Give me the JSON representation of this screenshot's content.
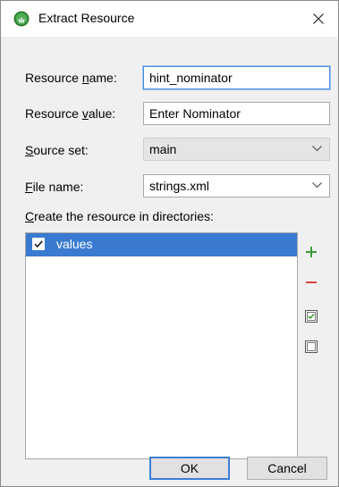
{
  "dialog": {
    "title": "Extract Resource",
    "app_icon": "android-studio-icon",
    "close_icon": "close-icon"
  },
  "form": {
    "resource_name": {
      "label_pre": "Resource ",
      "label_mnemonic": "n",
      "label_post": "ame:",
      "value": "hint_nominator"
    },
    "resource_value": {
      "label_pre": "Resource ",
      "label_mnemonic": "v",
      "label_post": "alue:",
      "value": "Enter Nominator"
    },
    "source_set": {
      "label_pre": "",
      "label_mnemonic": "S",
      "label_post": "ource set:",
      "value": "main"
    },
    "file_name": {
      "label_pre": "",
      "label_mnemonic": "F",
      "label_post": "ile name:",
      "value": "strings.xml"
    }
  },
  "directories": {
    "label_mnemonic": "C",
    "label_post": "reate the resource in directories:",
    "items": [
      {
        "label": "values",
        "checked": true,
        "selected": true
      }
    ],
    "side_buttons": [
      "add-icon",
      "remove-icon",
      "select-all-icon",
      "unselect-all-icon"
    ]
  },
  "buttons": {
    "ok": "OK",
    "cancel": "Cancel"
  },
  "colors": {
    "selection": "#3a7ad1",
    "add_green": "#3d9a3d",
    "remove_red": "#d9453b",
    "focus_blue": "#4d8fe3"
  }
}
